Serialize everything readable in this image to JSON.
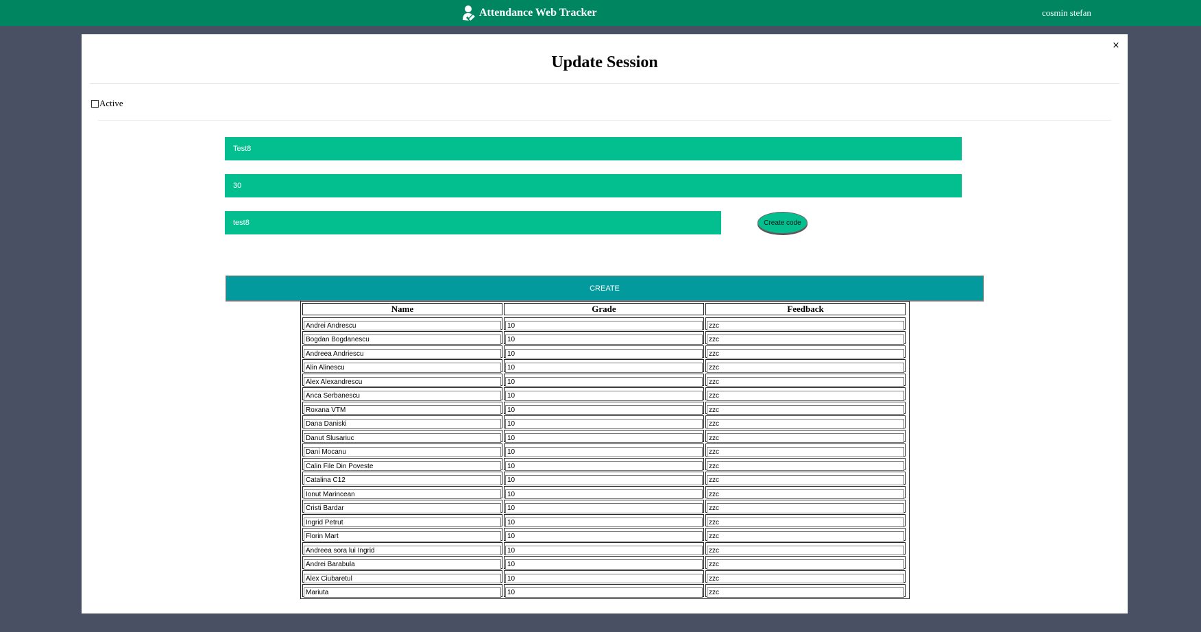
{
  "app": {
    "title": "Attendance Web Tracker",
    "user": "cosmin stefan"
  },
  "modal": {
    "title": "Update Session",
    "close_label": "×",
    "active_label": "Active",
    "active_checked": false,
    "fields": {
      "name_value": "Test8",
      "duration_value": "30",
      "code_value": "test8"
    },
    "create_code_label": "Create code",
    "create_label": "CREATE"
  },
  "table": {
    "headers": [
      "Name",
      "Grade",
      "Feedback"
    ],
    "rows": [
      {
        "name": "Andrei Andrescu",
        "grade": "10",
        "feedback": "zzc"
      },
      {
        "name": "Bogdan Bogdanescu",
        "grade": "10",
        "feedback": "zzc"
      },
      {
        "name": "Andreea Andriescu",
        "grade": "10",
        "feedback": "zzc"
      },
      {
        "name": "Alin Alinescu",
        "grade": "10",
        "feedback": "zzc"
      },
      {
        "name": "Alex Alexandrescu",
        "grade": "10",
        "feedback": "zzc"
      },
      {
        "name": "Anca Serbanescu",
        "grade": "10",
        "feedback": "zzc"
      },
      {
        "name": "Roxana VTM",
        "grade": "10",
        "feedback": "zzc"
      },
      {
        "name": "Dana Daniski",
        "grade": "10",
        "feedback": "zzc"
      },
      {
        "name": "Danut Slusariuc",
        "grade": "10",
        "feedback": "zzc"
      },
      {
        "name": "Dani Mocanu",
        "grade": "10",
        "feedback": "zzc"
      },
      {
        "name": "Calin File Din Poveste",
        "grade": "10",
        "feedback": "zzc"
      },
      {
        "name": "Catalina C12",
        "grade": "10",
        "feedback": "zzc"
      },
      {
        "name": "Ionut Marincean",
        "grade": "10",
        "feedback": "zzc"
      },
      {
        "name": "Cristi Bardar",
        "grade": "10",
        "feedback": "zzc"
      },
      {
        "name": "Ingrid Petrut",
        "grade": "10",
        "feedback": "zzc"
      },
      {
        "name": "Florin Mart",
        "grade": "10",
        "feedback": "zzc"
      },
      {
        "name": "Andreea sora lui Ingrid",
        "grade": "10",
        "feedback": "zzc"
      },
      {
        "name": "Andrei Barabula",
        "grade": "10",
        "feedback": "zzc"
      },
      {
        "name": "Alex Ciubaretul",
        "grade": "10",
        "feedback": "zzc"
      },
      {
        "name": "Mariuta",
        "grade": "10",
        "feedback": "zzc"
      }
    ]
  },
  "colors": {
    "topbar": "#008561",
    "field": "#03bf8f",
    "create_button": "#029a9c",
    "page_background": "#4a5063"
  },
  "icons": {
    "brand": "user-check-icon",
    "close": "close-icon"
  }
}
